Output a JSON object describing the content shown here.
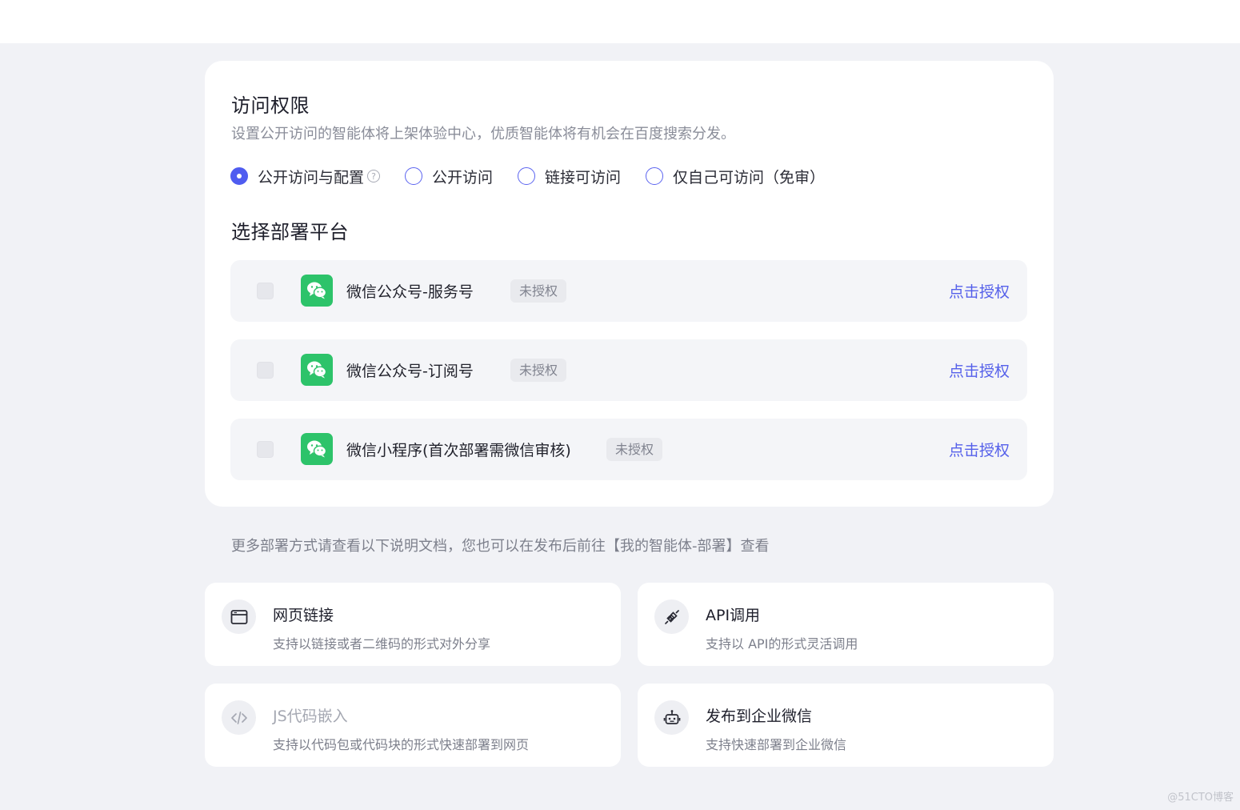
{
  "access": {
    "title": "访问权限",
    "description": "设置公开访问的智能体将上架体验中心，优质智能体将有机会在百度搜索分发。",
    "options": [
      {
        "label": "公开访问与配置",
        "checked": true
      },
      {
        "label": "公开访问",
        "checked": false
      },
      {
        "label": "链接可访问",
        "checked": false
      },
      {
        "label": "仅自己可访问（免审）",
        "checked": false
      }
    ],
    "help_glyph": "?"
  },
  "platforms": {
    "title": "选择部署平台",
    "items": [
      {
        "name": "微信公众号-服务号",
        "status": "未授权",
        "action": "点击授权"
      },
      {
        "name": "微信公众号-订阅号",
        "status": "未授权",
        "action": "点击授权"
      },
      {
        "name": "微信小程序(首次部署需微信审核)",
        "status": "未授权",
        "action": "点击授权"
      }
    ]
  },
  "more_text": "更多部署方式请查看以下说明文档，您也可以在发布后前往【我的智能体-部署】查看",
  "deploy": [
    {
      "title": "网页链接",
      "desc": "支持以链接或者二维码的形式对外分享",
      "icon": "browser-icon"
    },
    {
      "title": "API调用",
      "desc": "支持以 API的形式灵活调用",
      "icon": "plug-icon"
    },
    {
      "title": "JS代码嵌入",
      "desc": "支持以代码包或代码块的形式快速部署到网页",
      "icon": "code-icon"
    },
    {
      "title": "发布到企业微信",
      "desc": "支持快速部署到企业微信",
      "icon": "robot-icon"
    }
  ],
  "watermark": "@51CTO博客",
  "colors": {
    "accent": "#4f5cf0",
    "wechat_green": "#2dc36a",
    "link": "#5560ea"
  }
}
